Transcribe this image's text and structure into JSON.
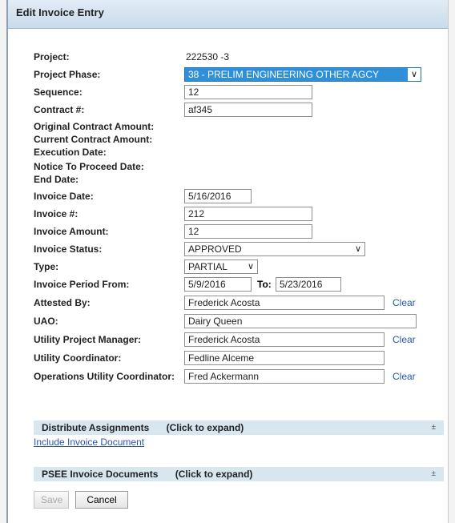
{
  "dialog": {
    "title": "Edit Invoice Entry"
  },
  "fields": {
    "project": {
      "label": "Project:",
      "value": "222530 -3"
    },
    "project_phase": {
      "label": "Project Phase:",
      "value": "38 - PRELIM ENGINEERING OTHER AGCY"
    },
    "sequence": {
      "label": "Sequence:",
      "value": "12"
    },
    "contract_no": {
      "label": "Contract #:",
      "value": "af345"
    },
    "original_contract_amount": {
      "label": "Original Contract Amount:"
    },
    "current_contract_amount": {
      "label": "Current Contract Amount:"
    },
    "execution_date": {
      "label": "Execution Date:"
    },
    "notice_to_proceed_date": {
      "label": "Notice To Proceed Date:"
    },
    "end_date": {
      "label": "End Date:"
    },
    "invoice_date": {
      "label": "Invoice Date:",
      "value": "5/16/2016"
    },
    "invoice_no": {
      "label": "Invoice #:",
      "value": "212"
    },
    "invoice_amount": {
      "label": "Invoice Amount:",
      "value": "12"
    },
    "invoice_status": {
      "label": "Invoice Status:",
      "value": "APPROVED"
    },
    "type": {
      "label": "Type:",
      "value": "PARTIAL"
    },
    "invoice_period": {
      "label": "Invoice Period From:",
      "from": "5/9/2016",
      "to_label": "To:",
      "to": "5/23/2016"
    },
    "attested_by": {
      "label": "Attested By:",
      "value": "Frederick Acosta",
      "clear": "Clear"
    },
    "uao": {
      "label": "UAO:",
      "value": "Dairy Queen"
    },
    "utility_project_manager": {
      "label": "Utility Project Manager:",
      "value": "Frederick Acosta",
      "clear": "Clear"
    },
    "utility_coordinator": {
      "label": "Utility Coordinator:",
      "value": "Fedline Alceme"
    },
    "operations_utility_coordinator": {
      "label": "Operations Utility Coordinator:",
      "value": "Fred Ackermann",
      "clear": "Clear"
    }
  },
  "sections": {
    "distribute": {
      "title": "Distribute Assignments",
      "hint": "(Click to expand)",
      "icon": "±"
    },
    "include_doc_link": "Include Invoice Document",
    "psee": {
      "title": "PSEE Invoice Documents",
      "hint": "(Click to expand)",
      "icon": "±"
    }
  },
  "buttons": {
    "save": "Save",
    "cancel": "Cancel"
  },
  "colors": {
    "title_bg": "#c9dbec",
    "section_bg": "#d8e6f0",
    "selected_bg": "#2f8fd8",
    "link": "#2a55b8"
  }
}
